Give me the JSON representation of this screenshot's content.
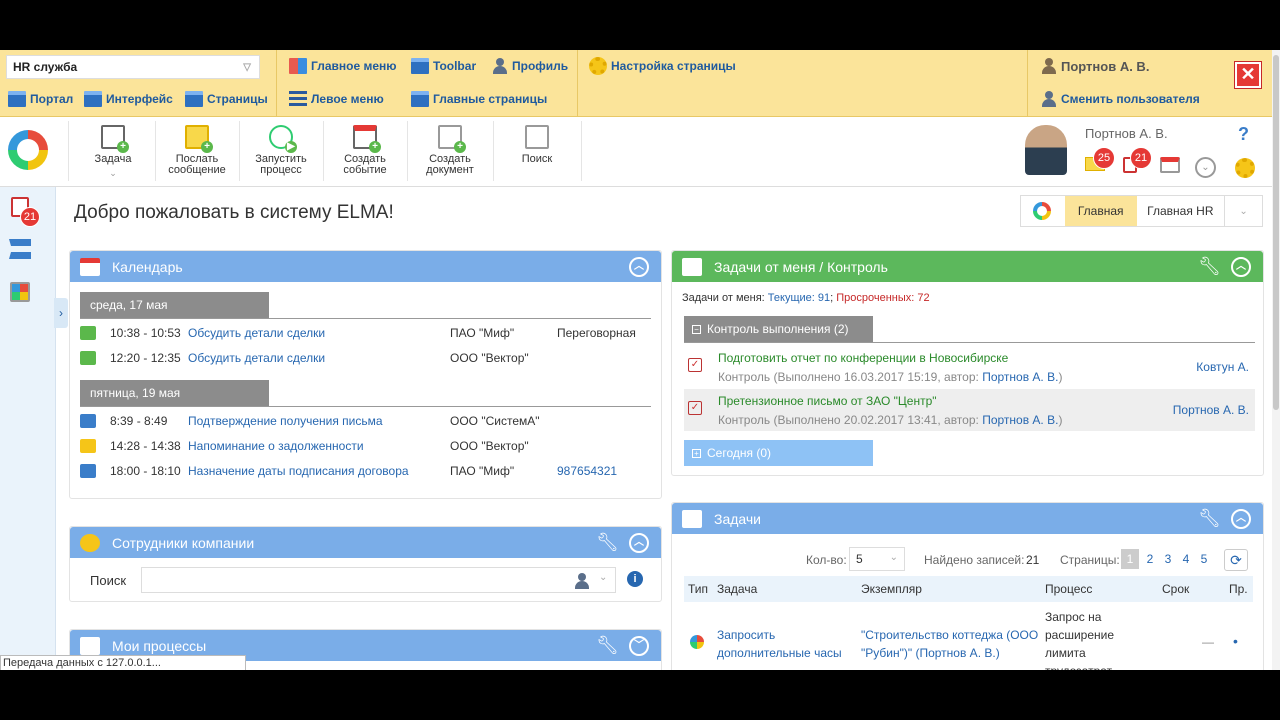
{
  "admin_bar": {
    "portal_select": "HR служба",
    "links": {
      "portal": "Портал",
      "interface": "Интерфейс",
      "pages": "Страницы",
      "main_menu": "Главное меню",
      "left_menu": "Левое меню",
      "toolbar": "Toolbar",
      "main_pages": "Главные страницы",
      "profile": "Профиль",
      "page_settings": "Настройка страницы",
      "user": "Портнов А. В.",
      "switch_user": "Сменить пользователя"
    },
    "close": "✕"
  },
  "toolbar": {
    "task": "Задача",
    "send_message": [
      "Послать",
      "сообщение"
    ],
    "start_process": [
      "Запустить",
      "процесс"
    ],
    "create_event": [
      "Создать",
      "событие"
    ],
    "create_document": [
      "Создать",
      "документ"
    ],
    "search": "Поиск",
    "user_name": "Портнов А. В.",
    "messages_count": "25",
    "tasks_count": "21",
    "help": "?"
  },
  "left_rail": {
    "tasks_badge": "21",
    "toggle": "›"
  },
  "page": {
    "welcome": "Добро пожаловать в систему ELMA!",
    "home_tabs": {
      "main": "Главная",
      "hr": "Главная HR"
    }
  },
  "calendar": {
    "title": "Календарь",
    "days": [
      {
        "label": "среда, 17 мая",
        "events": [
          {
            "time": "10:38 - 10:53",
            "subject": "Обсудить детали сделки",
            "company": "ПАО \"Миф\"",
            "extra": "Переговорная",
            "icon_color": "#5bb84b"
          },
          {
            "time": "12:20 - 12:35",
            "subject": "Обсудить детали сделки",
            "company": "ООО \"Вектор\"",
            "extra": "",
            "icon_color": "#5bb84b"
          }
        ]
      },
      {
        "label": "пятница, 19 мая",
        "events": [
          {
            "time": "8:39 - 8:49",
            "subject": "Подтверждение получения письма",
            "company": "ООО \"СистемА\"",
            "extra": "",
            "icon_color": "#3a7dc9"
          },
          {
            "time": "14:28 - 14:38",
            "subject": "Напоминание о задолженности",
            "company": "ООО \"Вектор\"",
            "extra": "",
            "icon_color": "#f5c518"
          },
          {
            "time": "18:00 - 18:10",
            "subject": "Назначение даты подписания договора",
            "company": "ПАО \"Миф\"",
            "extra": "987654321",
            "icon_color": "#3a7dc9"
          }
        ]
      }
    ]
  },
  "employees": {
    "title": "Сотрудники компании",
    "search_label": "Поиск",
    "search_value": ""
  },
  "my_processes": {
    "title": "Мои процессы"
  },
  "control": {
    "title": "Задачи от меня / Контроль",
    "summary_prefix": "Задачи от меня:",
    "current": "Текущие: 91",
    "overdue": "Просроченных: 72",
    "group_control": "Контроль выполнения (2)",
    "items": [
      {
        "title": "Подготовить отчет по конференции в Новосибирске",
        "meta": "Контроль (Выполнено 16.03.2017 15:19, автор:",
        "author": "Портнов А. В.",
        "meta_end": ")",
        "assignee": "Ковтун А."
      },
      {
        "title": "Претензионное письмо от ЗАО \"Центр\"",
        "meta": "Контроль (Выполнено 20.02.2017 13:41, автор:",
        "author": "Портнов А. В.",
        "meta_end": ")",
        "assignee": "Портнов А. В."
      }
    ],
    "group_today": "Сегодня (0)"
  },
  "tasks": {
    "title": "Задачи",
    "count_label": "Кол-во:",
    "count_value": "5",
    "found_label": "Найдено записей:",
    "found_value": "21",
    "pages_label": "Страницы:",
    "pages": [
      "1",
      "2",
      "3",
      "4",
      "5"
    ],
    "columns": [
      "Тип",
      "Задача",
      "Экземпляр",
      "Процесс",
      "Срок",
      "Пр."
    ],
    "rows": [
      {
        "task": "Запросить дополнительные часы",
        "instance": "\"Строительство коттеджа (ООО \"Рубин\")\"",
        "instance_author": "Портнов А. В.",
        "process": "Запрос на расширение лимита трудозатрат",
        "due": "—",
        "priority": "•"
      }
    ]
  },
  "status_bar": "Передача данных с 127.0.0.1..."
}
